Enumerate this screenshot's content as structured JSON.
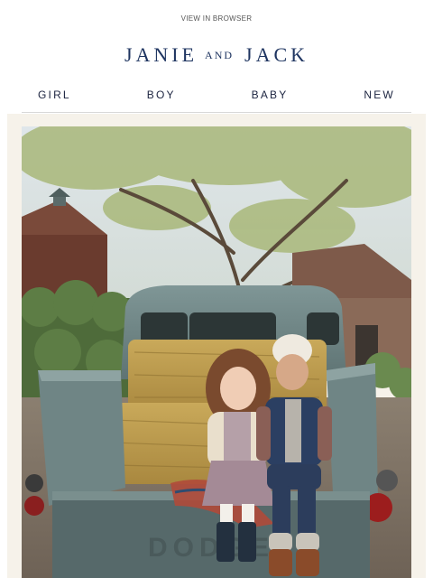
{
  "preheader": {
    "view_in_browser": "VIEW IN BROWSER"
  },
  "brand": {
    "word1": "JANIE",
    "word2": "AND",
    "word3": "JACK"
  },
  "nav": {
    "items": [
      {
        "label": "GIRL"
      },
      {
        "label": "BOY"
      },
      {
        "label": "BABY"
      },
      {
        "label": "NEW"
      }
    ]
  },
  "hero": {
    "description_icon": "hero-photo-kids-on-truck-hay-bales",
    "tailgate_text": "DODGE"
  },
  "colors": {
    "brand_navy": "#1f3561",
    "frame_cream": "#f6f2ea",
    "divider": "#d9d9d9"
  }
}
